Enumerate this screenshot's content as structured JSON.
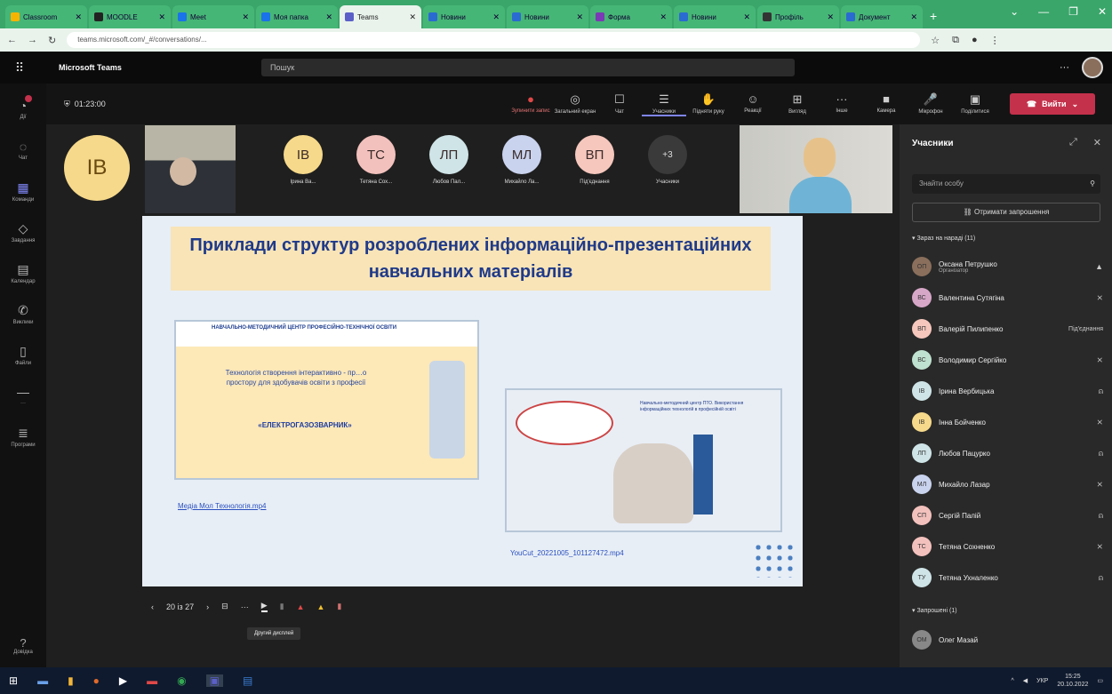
{
  "browser": {
    "tabs": [
      {
        "label": "Classroom",
        "fav": "#f4b400"
      },
      {
        "label": "MOODLE",
        "fav": "#222"
      },
      {
        "label": "Meet",
        "fav": "#1a73e8"
      },
      {
        "label": "Моя папка",
        "fav": "#1a73e8"
      },
      {
        "label": "Teams",
        "fav": "#5b5fc7",
        "active": true
      },
      {
        "label": "Новини",
        "fav": "#2a6bd1"
      },
      {
        "label": "Новини",
        "fav": "#2a6bd1"
      },
      {
        "label": "Форма",
        "fav": "#7a3ab5"
      },
      {
        "label": "Новини",
        "fav": "#2a6bd1"
      },
      {
        "label": "Профіль",
        "fav": "#333"
      },
      {
        "label": "Документ",
        "fav": "#2a6bd1"
      }
    ],
    "url": "teams.microsoft.com/_#/conversations/...",
    "win_controls": [
      "⌄",
      "—",
      "❐",
      "✕"
    ]
  },
  "teams": {
    "app_name": "Microsoft Teams",
    "search_placeholder": "Пошук",
    "more": "···",
    "rail": [
      {
        "label": "Дії",
        "icon": "activity-icon"
      },
      {
        "label": "Чат",
        "icon": "chat-icon"
      },
      {
        "label": "Команди",
        "icon": "teams-icon",
        "on": true
      },
      {
        "label": "Завдання",
        "icon": "assignments-icon"
      },
      {
        "label": "Календар",
        "icon": "calendar-icon"
      },
      {
        "label": "Виклики",
        "icon": "calls-icon"
      },
      {
        "label": "Файли",
        "icon": "files-icon"
      },
      {
        "label": "···",
        "icon": "more-icon"
      },
      {
        "label": "Програми",
        "icon": "apps-icon"
      }
    ],
    "help_label": "Довідка"
  },
  "meeting": {
    "timer": "01:23:00",
    "toolbar": [
      {
        "label": "Зупинити запис",
        "icon": "●",
        "cls": "rec"
      },
      {
        "label": "Загальний екран",
        "icon": "◎"
      },
      {
        "label": "Чат",
        "icon": "☐"
      },
      {
        "label": "Учасники",
        "icon": "☰",
        "cls": "sel"
      },
      {
        "label": "Підняти руку",
        "icon": "✋"
      },
      {
        "label": "Реакції",
        "icon": "☺"
      },
      {
        "label": "Вигляд",
        "icon": "⊞"
      },
      {
        "label": "Інше",
        "icon": "···"
      },
      {
        "label": "Камера",
        "icon": "■"
      },
      {
        "label": "Мікрофон",
        "icon": "🎤"
      },
      {
        "label": "Поділитися",
        "icon": "▣"
      }
    ],
    "leave_label": "Вийти",
    "big_avatar": "IB",
    "participants_strip": [
      {
        "initials": "IB",
        "name": "Ірина Ва...",
        "color": "#f6d98a"
      },
      {
        "initials": "TC",
        "name": "Тетяна Сох...",
        "color": "#f3c1bd"
      },
      {
        "initials": "ЛП",
        "name": "Любов Пал...",
        "color": "#cfe4e7"
      },
      {
        "initials": "МЛ",
        "name": "Михайло Ла...",
        "color": "#c9d3ee"
      },
      {
        "initials": "ВП",
        "name": "Під'єднання",
        "color": "#f6c7bd"
      },
      {
        "initials": "+3",
        "name": "Учасники",
        "color": "#3a3a3a"
      }
    ]
  },
  "slide": {
    "title": "Приклади структур розроблених інформаційно-презентаційних навчальних матеріалів",
    "card1_head": "НАВЧАЛЬНО-МЕТОДИЧНИЙ ЦЕНТР ПРОФЕСІЙНО-ТЕХНІЧНОЇ ОСВІТИ",
    "card1_body": "Технологія створення інтерактивно - пр…о простору для здобувачів освіти з професії",
    "card1_sub": "«ЕЛЕКТРОГАЗОЗВАРНИК»",
    "link1": "Медіа Мол Технологія.mp4",
    "card2_txt": "Навчально-методичний центр ПТО. Використання інформаційних технологій в професійній освіті",
    "link2": "YouCut_20221005_101127472.mp4"
  },
  "slide_controls": {
    "prev": "‹",
    "page": "20 із 27",
    "next": "›",
    "tooltip": "Другий дисплей"
  },
  "panel": {
    "title": "Учасники",
    "search_placeholder": "Знайти особу",
    "invite": "Отримати запрошення",
    "section1": "▾ Зараз на нараді (11)",
    "section2": "▾ Запрошені (1)",
    "people": [
      {
        "initials": "ОП",
        "name": "Оксана Петрушко",
        "role": "Організатор",
        "color": "#8a6f5c",
        "mic": "▲"
      },
      {
        "initials": "ВС",
        "name": "Валентина Сутягіна",
        "color": "#d7a7c8",
        "mic": "⨯"
      },
      {
        "initials": "ВП",
        "name": "Валерій Пилипенко",
        "color": "#f6c7bd",
        "tag": "Під'єднання"
      },
      {
        "initials": "ВС",
        "name": "Володимир Сергійко",
        "color": "#bfe1cf",
        "mic": "⨯"
      },
      {
        "initials": "IB",
        "name": "Ірина Вербицька",
        "color": "#cfe4e7",
        "mic": "⍝"
      },
      {
        "initials": "IB",
        "name": "Інна Бойченко",
        "color": "#f6d98a",
        "mic": "⨯"
      },
      {
        "initials": "ЛП",
        "name": "Любов Пацурко",
        "color": "#cfe4e7",
        "mic": "⍝"
      },
      {
        "initials": "МЛ",
        "name": "Михайло Лазар",
        "color": "#c9d3ee",
        "mic": "⨯"
      },
      {
        "initials": "СП",
        "name": "Сергій Палій",
        "color": "#f3c1bd",
        "mic": "⍝"
      },
      {
        "initials": "ТС",
        "name": "Тетяна Сохненко",
        "color": "#f3c1bd",
        "mic": "⨯"
      },
      {
        "initials": "ТУ",
        "name": "Тетяна Ухналенко",
        "color": "#cfe4e7",
        "mic": "⍝"
      }
    ],
    "invited": [
      {
        "initials": "ОМ",
        "name": "Олег Мазай",
        "color": "#888"
      }
    ]
  },
  "taskbar": {
    "clock": "15:25",
    "date": "20.10.2022",
    "lang": "УКР"
  }
}
